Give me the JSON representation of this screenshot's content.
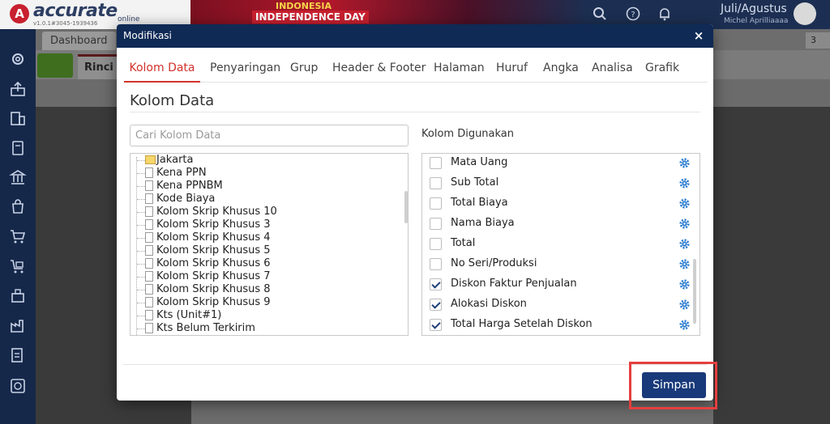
{
  "brand": {
    "logo_letter": "A",
    "name": "accurate",
    "suffix": "online",
    "version": "v1.0.1#3045-1939436"
  },
  "banner": {
    "line1": "INDONESIA",
    "line2": "INDEPENDENCE DAY"
  },
  "user": {
    "period": "Juli/Agustus",
    "name": "Michel Aprilliaaaa"
  },
  "background": {
    "tabs": [
      "Dashboard"
    ],
    "subtab": "Rinci",
    "page_select": "3"
  },
  "modal": {
    "title": "Modifikasi",
    "close": "×",
    "tabs": [
      {
        "label": "Kolom Data",
        "active": true
      },
      {
        "label": "Penyaringan",
        "active": false
      },
      {
        "label": "Grup",
        "active": false
      },
      {
        "label": "Header & Footer",
        "active": false
      },
      {
        "label": "Halaman",
        "active": false
      },
      {
        "label": "Huruf",
        "active": false
      },
      {
        "label": "Angka",
        "active": false
      },
      {
        "label": "Analisa",
        "active": false
      },
      {
        "label": "Grafik",
        "active": false
      }
    ],
    "section_title": "Kolom Data",
    "search": {
      "placeholder": "Cari Kolom Data",
      "value": ""
    },
    "tree": [
      {
        "label": "Jakarta",
        "type": "folder"
      },
      {
        "label": "Kena PPN",
        "type": "file"
      },
      {
        "label": "Kena PPNBM",
        "type": "file"
      },
      {
        "label": "Kode Biaya",
        "type": "file"
      },
      {
        "label": "Kolom Skrip Khusus 10",
        "type": "file"
      },
      {
        "label": "Kolom Skrip Khusus 3",
        "type": "file"
      },
      {
        "label": "Kolom Skrip Khusus 4",
        "type": "file"
      },
      {
        "label": "Kolom Skrip Khusus 5",
        "type": "file"
      },
      {
        "label": "Kolom Skrip Khusus 6",
        "type": "file"
      },
      {
        "label": "Kolom Skrip Khusus 7",
        "type": "file"
      },
      {
        "label": "Kolom Skrip Khusus 8",
        "type": "file"
      },
      {
        "label": "Kolom Skrip Khusus 9",
        "type": "file"
      },
      {
        "label": "Kts (Unit#1)",
        "type": "file"
      },
      {
        "label": "Kts Belum Terkirim",
        "type": "file"
      }
    ],
    "used_label": "Kolom Digunakan",
    "used_columns": [
      {
        "label": "Mata Uang",
        "checked": false
      },
      {
        "label": "Sub Total",
        "checked": false
      },
      {
        "label": "Total Biaya",
        "checked": false
      },
      {
        "label": "Nama Biaya",
        "checked": false
      },
      {
        "label": "Total",
        "checked": false
      },
      {
        "label": "No Seri/Produksi",
        "checked": false
      },
      {
        "label": "Diskon Faktur Penjualan",
        "checked": true
      },
      {
        "label": "Alokasi Diskon",
        "checked": true
      },
      {
        "label": "Total Harga Setelah Diskon",
        "checked": true
      }
    ],
    "save_button": "Simpan"
  },
  "colors": {
    "header_navy": "#0f2a55",
    "active_tab_red": "#d2322d",
    "save_button": "#193a7a",
    "gear_blue": "#2f7fd0",
    "highlight_red": "#e53f3f"
  },
  "icons": {
    "sidebar": [
      "gear-icon",
      "upload-icon",
      "building-icon",
      "book-icon",
      "bank-icon",
      "bag-icon",
      "cart-icon",
      "cart-box-icon",
      "inventory-icon",
      "factory-icon",
      "tax-icon",
      "chart-icon"
    ],
    "topbar": [
      "search-icon",
      "help-icon",
      "bell-icon"
    ],
    "row_settings": "gear-icon"
  }
}
